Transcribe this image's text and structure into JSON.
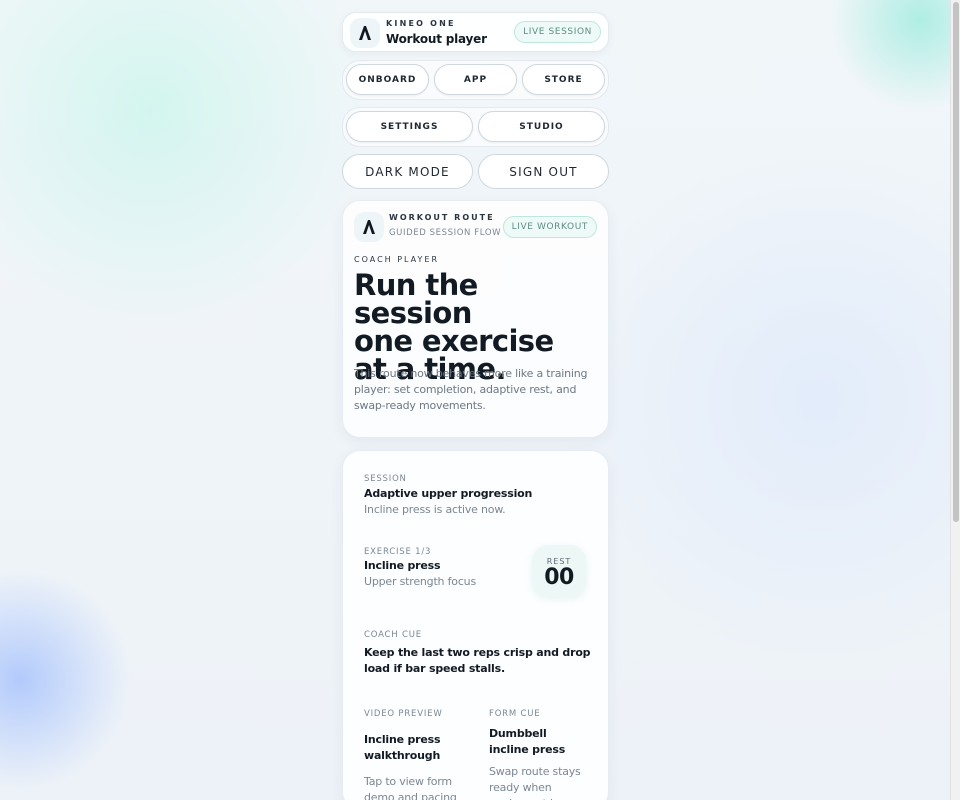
{
  "header": {
    "brand": "KINEO ONE",
    "page_title": "Workout player",
    "badge": "LIVE SESSION"
  },
  "nav": {
    "row1": [
      "ONBOARD",
      "APP",
      "STORE"
    ],
    "row2": [
      "SETTINGS",
      "STUDIO"
    ],
    "dark_mode": "DARK MODE",
    "sign_out": "SIGN OUT"
  },
  "hero": {
    "route_label": "WORKOUT ROUTE",
    "route_sub": "GUIDED SESSION FLOW",
    "badge": "LIVE WORKOUT",
    "eyebrow": "COACH PLAYER",
    "headline": [
      "Run the session",
      "one exercise",
      "at a time."
    ],
    "description": "This route now behaves more like a training player: set completion, adaptive rest, and swap-ready movements."
  },
  "session": {
    "label": "SESSION",
    "title": "Adaptive upper progression",
    "sub": "Incline press is active now.",
    "exercise_label": "EXERCISE 1/3",
    "exercise_title": "Incline press",
    "exercise_sub": "Upper strength focus",
    "rest_label": "REST",
    "rest_value": "00",
    "cue_label": "COACH CUE",
    "cue_text": "Keep the last two reps crisp and drop load if bar speed stalls.",
    "video_label": "VIDEO PREVIEW",
    "video_title": "Incline press walkthrough",
    "video_sub": "Tap to view form demo and pacing",
    "form_label": "FORM CUE",
    "form_title": "Dumbbell incline press",
    "form_sub": "Swap route stays ready when equipment is busy"
  },
  "icons": {
    "logo": "kineo-logo-icon"
  },
  "colors": {
    "accent": "#bfe6dc",
    "badge_text": "#5f8c84",
    "ink": "#121a24"
  }
}
